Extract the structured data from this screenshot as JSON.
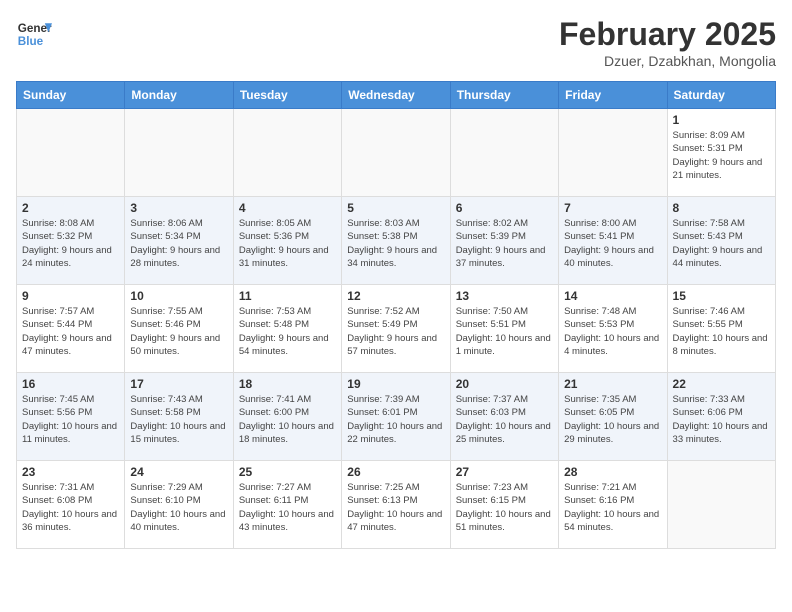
{
  "header": {
    "logo_line1": "General",
    "logo_line2": "Blue",
    "month": "February 2025",
    "location": "Dzuer, Dzabkhan, Mongolia"
  },
  "weekdays": [
    "Sunday",
    "Monday",
    "Tuesday",
    "Wednesday",
    "Thursday",
    "Friday",
    "Saturday"
  ],
  "weeks": [
    [
      {
        "day": "",
        "info": ""
      },
      {
        "day": "",
        "info": ""
      },
      {
        "day": "",
        "info": ""
      },
      {
        "day": "",
        "info": ""
      },
      {
        "day": "",
        "info": ""
      },
      {
        "day": "",
        "info": ""
      },
      {
        "day": "1",
        "info": "Sunrise: 8:09 AM\nSunset: 5:31 PM\nDaylight: 9 hours and 21 minutes."
      }
    ],
    [
      {
        "day": "2",
        "info": "Sunrise: 8:08 AM\nSunset: 5:32 PM\nDaylight: 9 hours and 24 minutes."
      },
      {
        "day": "3",
        "info": "Sunrise: 8:06 AM\nSunset: 5:34 PM\nDaylight: 9 hours and 28 minutes."
      },
      {
        "day": "4",
        "info": "Sunrise: 8:05 AM\nSunset: 5:36 PM\nDaylight: 9 hours and 31 minutes."
      },
      {
        "day": "5",
        "info": "Sunrise: 8:03 AM\nSunset: 5:38 PM\nDaylight: 9 hours and 34 minutes."
      },
      {
        "day": "6",
        "info": "Sunrise: 8:02 AM\nSunset: 5:39 PM\nDaylight: 9 hours and 37 minutes."
      },
      {
        "day": "7",
        "info": "Sunrise: 8:00 AM\nSunset: 5:41 PM\nDaylight: 9 hours and 40 minutes."
      },
      {
        "day": "8",
        "info": "Sunrise: 7:58 AM\nSunset: 5:43 PM\nDaylight: 9 hours and 44 minutes."
      }
    ],
    [
      {
        "day": "9",
        "info": "Sunrise: 7:57 AM\nSunset: 5:44 PM\nDaylight: 9 hours and 47 minutes."
      },
      {
        "day": "10",
        "info": "Sunrise: 7:55 AM\nSunset: 5:46 PM\nDaylight: 9 hours and 50 minutes."
      },
      {
        "day": "11",
        "info": "Sunrise: 7:53 AM\nSunset: 5:48 PM\nDaylight: 9 hours and 54 minutes."
      },
      {
        "day": "12",
        "info": "Sunrise: 7:52 AM\nSunset: 5:49 PM\nDaylight: 9 hours and 57 minutes."
      },
      {
        "day": "13",
        "info": "Sunrise: 7:50 AM\nSunset: 5:51 PM\nDaylight: 10 hours and 1 minute."
      },
      {
        "day": "14",
        "info": "Sunrise: 7:48 AM\nSunset: 5:53 PM\nDaylight: 10 hours and 4 minutes."
      },
      {
        "day": "15",
        "info": "Sunrise: 7:46 AM\nSunset: 5:55 PM\nDaylight: 10 hours and 8 minutes."
      }
    ],
    [
      {
        "day": "16",
        "info": "Sunrise: 7:45 AM\nSunset: 5:56 PM\nDaylight: 10 hours and 11 minutes."
      },
      {
        "day": "17",
        "info": "Sunrise: 7:43 AM\nSunset: 5:58 PM\nDaylight: 10 hours and 15 minutes."
      },
      {
        "day": "18",
        "info": "Sunrise: 7:41 AM\nSunset: 6:00 PM\nDaylight: 10 hours and 18 minutes."
      },
      {
        "day": "19",
        "info": "Sunrise: 7:39 AM\nSunset: 6:01 PM\nDaylight: 10 hours and 22 minutes."
      },
      {
        "day": "20",
        "info": "Sunrise: 7:37 AM\nSunset: 6:03 PM\nDaylight: 10 hours and 25 minutes."
      },
      {
        "day": "21",
        "info": "Sunrise: 7:35 AM\nSunset: 6:05 PM\nDaylight: 10 hours and 29 minutes."
      },
      {
        "day": "22",
        "info": "Sunrise: 7:33 AM\nSunset: 6:06 PM\nDaylight: 10 hours and 33 minutes."
      }
    ],
    [
      {
        "day": "23",
        "info": "Sunrise: 7:31 AM\nSunset: 6:08 PM\nDaylight: 10 hours and 36 minutes."
      },
      {
        "day": "24",
        "info": "Sunrise: 7:29 AM\nSunset: 6:10 PM\nDaylight: 10 hours and 40 minutes."
      },
      {
        "day": "25",
        "info": "Sunrise: 7:27 AM\nSunset: 6:11 PM\nDaylight: 10 hours and 43 minutes."
      },
      {
        "day": "26",
        "info": "Sunrise: 7:25 AM\nSunset: 6:13 PM\nDaylight: 10 hours and 47 minutes."
      },
      {
        "day": "27",
        "info": "Sunrise: 7:23 AM\nSunset: 6:15 PM\nDaylight: 10 hours and 51 minutes."
      },
      {
        "day": "28",
        "info": "Sunrise: 7:21 AM\nSunset: 6:16 PM\nDaylight: 10 hours and 54 minutes."
      },
      {
        "day": "",
        "info": ""
      }
    ]
  ]
}
